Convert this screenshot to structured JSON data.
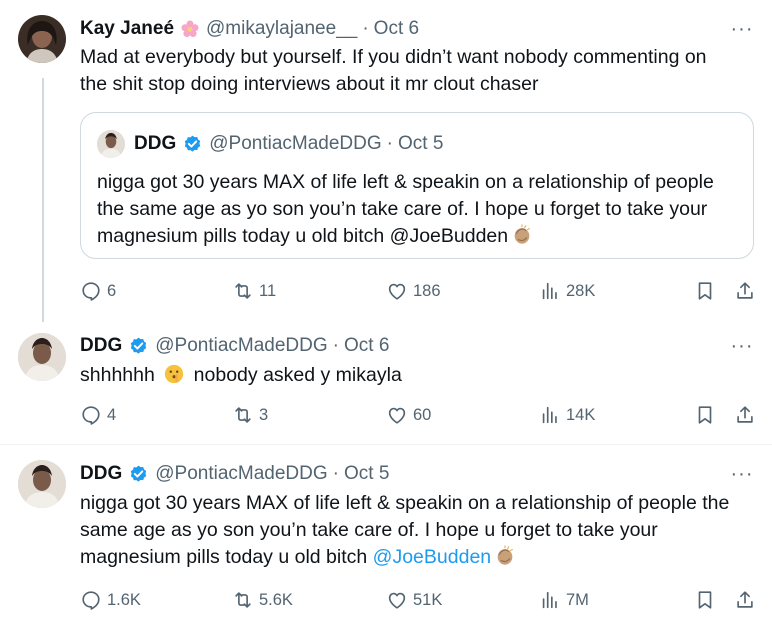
{
  "tweets": [
    {
      "name": "Kay Janeé",
      "handle": "@mikaylajanee__",
      "separator": "·",
      "date": "Oct 6",
      "text_line1": "Mad at everybody but yourself. If you didn’t want nobody commenting on",
      "text_line2": "the shit stop doing interviews about it mr clout chaser",
      "quote": {
        "name": "DDG",
        "handle": "@PontiacMadeDDG",
        "separator": "·",
        "date": "Oct 5",
        "line1": "nigga got 30 years MAX of life left & speakin on a relationship of people",
        "line2": "the same age as yo son you’n take care of. I hope u forget to take your",
        "line3": "magnesium pills today u old bitch @JoeBudden"
      },
      "stats": {
        "replies": "6",
        "reposts": "11",
        "likes": "186",
        "views": "28K"
      }
    },
    {
      "name": "DDG",
      "handle": "@PontiacMadeDDG",
      "separator": "·",
      "date": "Oct 6",
      "text_part1": "shhhhhh",
      "text_part2": "nobody asked y mikayla",
      "stats": {
        "replies": "4",
        "reposts": "3",
        "likes": "60",
        "views": "14K"
      }
    },
    {
      "name": "DDG",
      "handle": "@PontiacMadeDDG",
      "separator": "·",
      "date": "Oct 5",
      "line1": "nigga got 30 years MAX of life left & speakin on a relationship of people the",
      "line2": "same age as yo son you’n take care of. I hope u forget to take your",
      "line3": "magnesium pills today u old bitch",
      "mention": "@JoeBudden",
      "stats": {
        "replies": "1.6K",
        "reposts": "5.6K",
        "likes": "51K",
        "views": "7M"
      }
    }
  ],
  "more_glyph": "···",
  "colors": {
    "verified": "#1d9bf0",
    "mention": "#1d9bf0",
    "muted": "#536471",
    "border": "#cfd9de"
  },
  "icons": [
    "reply-icon",
    "repost-icon",
    "like-icon",
    "views-icon",
    "bookmark-icon",
    "share-icon",
    "verified-badge-icon",
    "more-icon"
  ]
}
